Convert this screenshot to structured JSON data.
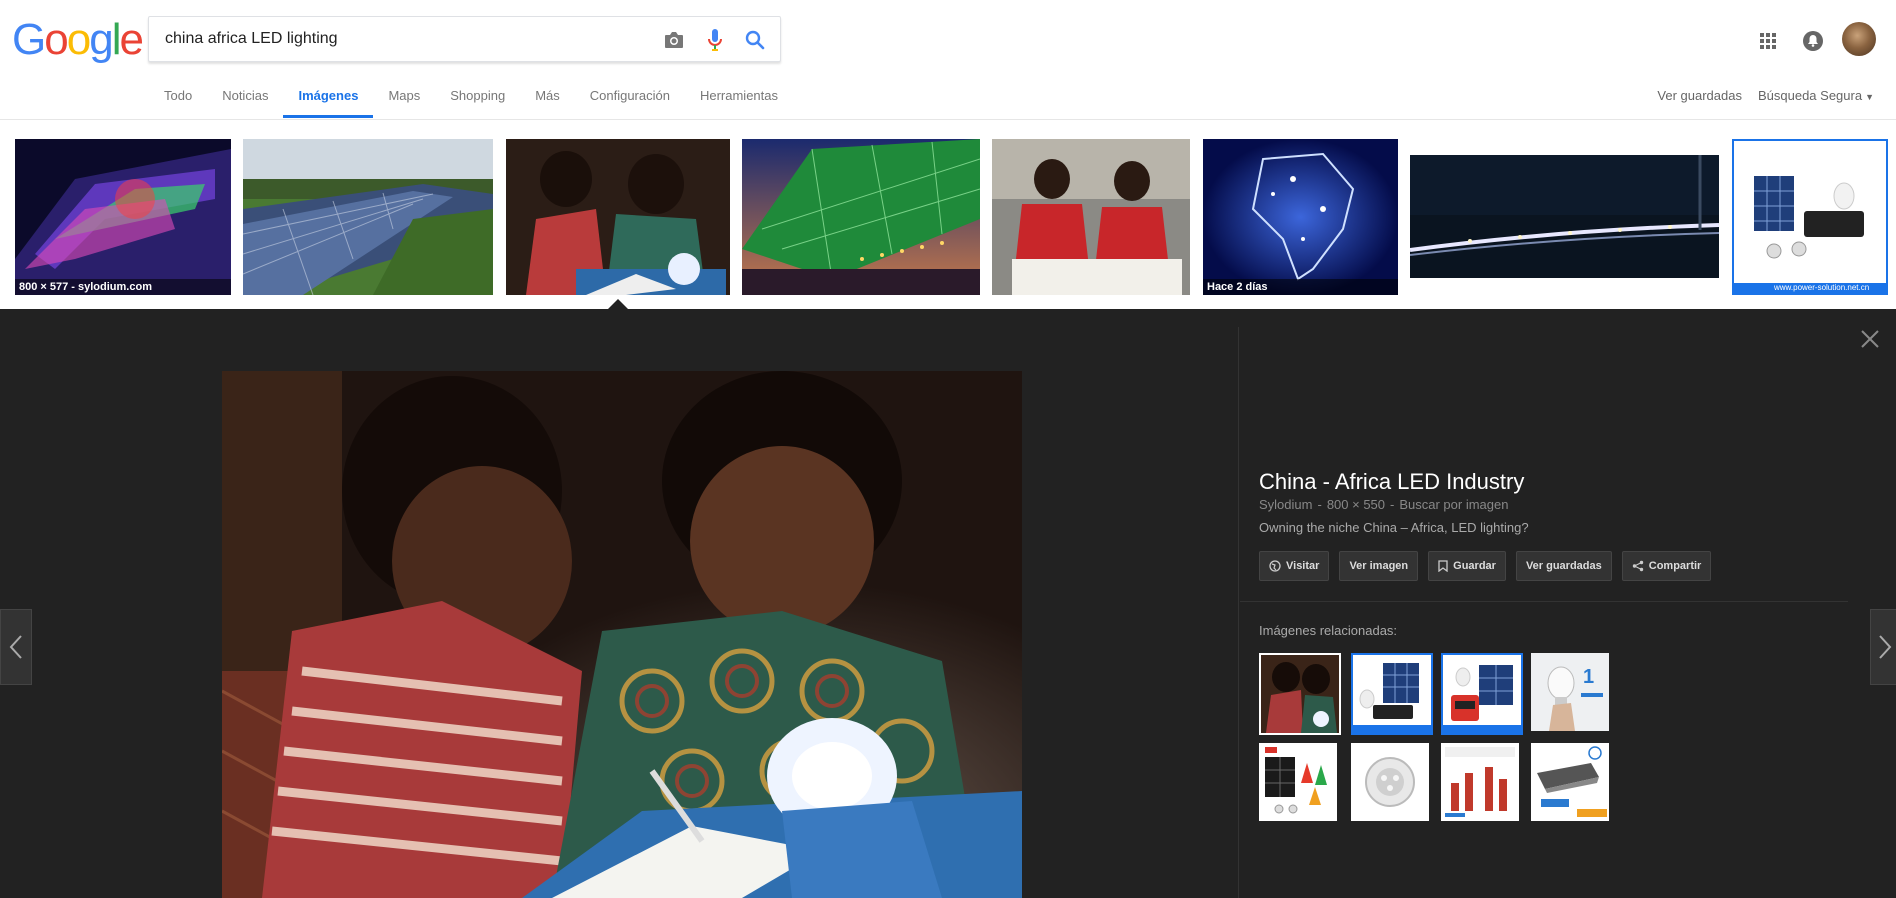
{
  "logo": {
    "letters": [
      "G",
      "o",
      "o",
      "g",
      "l",
      "e"
    ],
    "colors": [
      "#4285F4",
      "#EA4335",
      "#FBBC05",
      "#4285F4",
      "#34A853",
      "#EA4335"
    ]
  },
  "search": {
    "query": "china africa LED lighting"
  },
  "tabs": [
    {
      "label": "Todo"
    },
    {
      "label": "Noticias"
    },
    {
      "label": "Imágenes",
      "active": true
    },
    {
      "label": "Maps"
    },
    {
      "label": "Shopping"
    },
    {
      "label": "Más"
    },
    {
      "label": "Configuración"
    },
    {
      "label": "Herramientas"
    }
  ],
  "header_right": {
    "saved": "Ver guardadas",
    "safesearch": "Búsqueda Segura"
  },
  "thumbnails": {
    "t1_caption": "800 × 577 - sylodium.com",
    "t6_caption": "Hace 2 días",
    "t8_caption": "www.power-solution.net.cn"
  },
  "detail": {
    "title": "China - Africa LED Industry",
    "source": "Sylodium",
    "size": "800 × 550",
    "search_by_image": "Buscar por imagen",
    "description": "Owning the niche China – Africa, LED lighting?",
    "actions": {
      "visit": "Visitar",
      "view_image": "Ver imagen",
      "save": "Guardar",
      "view_saved": "Ver guardadas",
      "share": "Compartir"
    },
    "related_label": "Imágenes relacionadas:"
  },
  "accent_colors": {
    "blue": "#1a73e8",
    "viewer_bg": "#222222"
  }
}
